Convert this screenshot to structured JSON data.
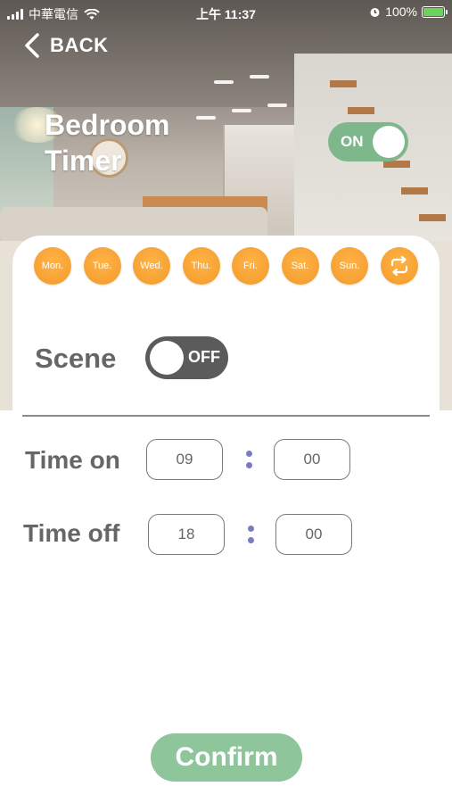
{
  "status_bar": {
    "carrier": "中華電信",
    "time": "上午 11:37",
    "battery_percent": "100%",
    "battery_color": "#6bd35b"
  },
  "nav": {
    "back_label": "BACK"
  },
  "header": {
    "title_line1": "Bedroom",
    "title_line2": "Timer",
    "power_toggle": {
      "label": "ON",
      "state": true,
      "color": "#7fb78d"
    }
  },
  "days": [
    {
      "label": "Mon."
    },
    {
      "label": "Tue."
    },
    {
      "label": "Wed."
    },
    {
      "label": "Thu."
    },
    {
      "label": "Fri."
    },
    {
      "label": "Sat."
    },
    {
      "label": "Sun."
    },
    {
      "label": "",
      "icon": "repeat-icon"
    }
  ],
  "day_color": "#f7a133",
  "scene": {
    "label": "Scene",
    "toggle_label": "OFF",
    "state": false
  },
  "time_on": {
    "label": "Time on",
    "hour": "09",
    "minute": "00"
  },
  "time_off": {
    "label": "Time off",
    "hour": "18",
    "minute": "00"
  },
  "confirm_label": "Confirm",
  "confirm_color": "#8ec59b"
}
